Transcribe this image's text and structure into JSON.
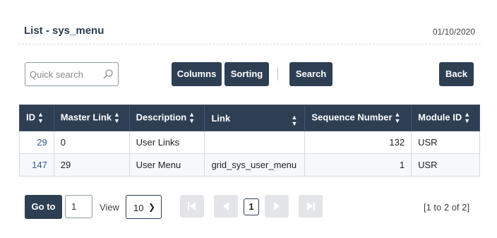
{
  "header": {
    "title": "List - sys_menu",
    "date": "01/10/2020"
  },
  "toolbar": {
    "search_placeholder": "Quick search",
    "search_value": "",
    "columns_label": "Columns",
    "sorting_label": "Sorting",
    "search_label": "Search",
    "back_label": "Back"
  },
  "grid": {
    "headers": [
      "ID",
      "Master Link",
      "Description",
      "Link",
      "Sequence Number",
      "Module ID"
    ],
    "rows": [
      {
        "id": "29",
        "master_link": "0",
        "description": "User Links",
        "link": "",
        "sequence": "132",
        "module": "USR"
      },
      {
        "id": "147",
        "master_link": "29",
        "description": "User Menu",
        "link": "grid_sys_user_menu",
        "sequence": "1",
        "module": "USR"
      }
    ]
  },
  "pager": {
    "goto_label": "Go to",
    "goto_value": "1",
    "view_label": "View",
    "view_value": "10",
    "current_page": "1",
    "info": "[1 to 2 of 2]"
  },
  "icons": {
    "search": "search-icon",
    "sort": "sort-icon",
    "first": "first-page-icon",
    "prev": "prev-page-icon",
    "next": "next-page-icon",
    "last": "last-page-icon",
    "chevron": "chevron-down-icon"
  },
  "colors": {
    "primary": "#2e3f54",
    "link": "#2e5a8c",
    "disabled": "#e3e5e8"
  }
}
